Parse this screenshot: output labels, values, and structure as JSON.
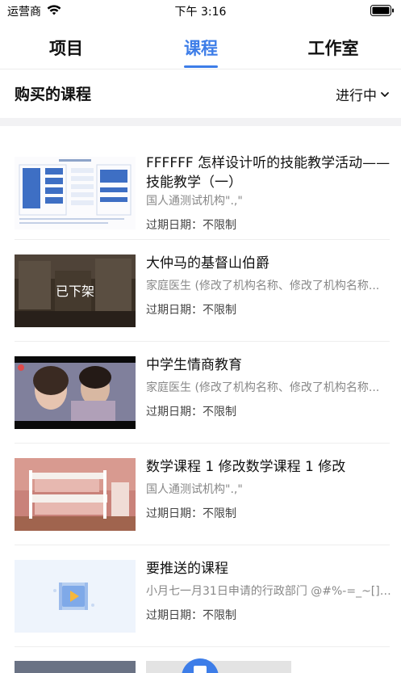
{
  "status_bar": {
    "carrier": "运营商",
    "time": "下午 3:16"
  },
  "tabs": [
    {
      "label": "项目",
      "active": false
    },
    {
      "label": "课程",
      "active": true
    },
    {
      "label": "工作室",
      "active": false
    }
  ],
  "section": {
    "title": "购买的课程",
    "filter_label": "进行中"
  },
  "courses": [
    {
      "title": "FFFFFF 怎样设计听的技能教学活动——技能教学（一）",
      "org": "国人通测试机构\".,\"",
      "expire_label": "过期日期：不限制",
      "thumb": "diagram"
    },
    {
      "title": "大仲马的基督山伯爵",
      "org": "家庭医生 (修改了机构名称、修改了机构名称...",
      "expire_label": "过期日期：不限制",
      "thumb": "room",
      "overlay": "已下架"
    },
    {
      "title": "中学生情商教育",
      "org": "家庭医生 (修改了机构名称、修改了机构名称...",
      "expire_label": "过期日期：不限制",
      "thumb": "video"
    },
    {
      "title": "数学课程 1 修改数学课程 1 修改",
      "org": "国人通测试机构\".,\"",
      "expire_label": "过期日期：不限制",
      "thumb": "bedroom"
    },
    {
      "title": "要推送的课程",
      "org": "小月七一月31日申请的行政部门 @#%-=_~[];....",
      "expire_label": "过期日期：不限制",
      "thumb": "placeholder"
    }
  ],
  "colors": {
    "accent": "#3d7de8",
    "divider": "#eeeeee",
    "band": "#f2f2f4"
  }
}
